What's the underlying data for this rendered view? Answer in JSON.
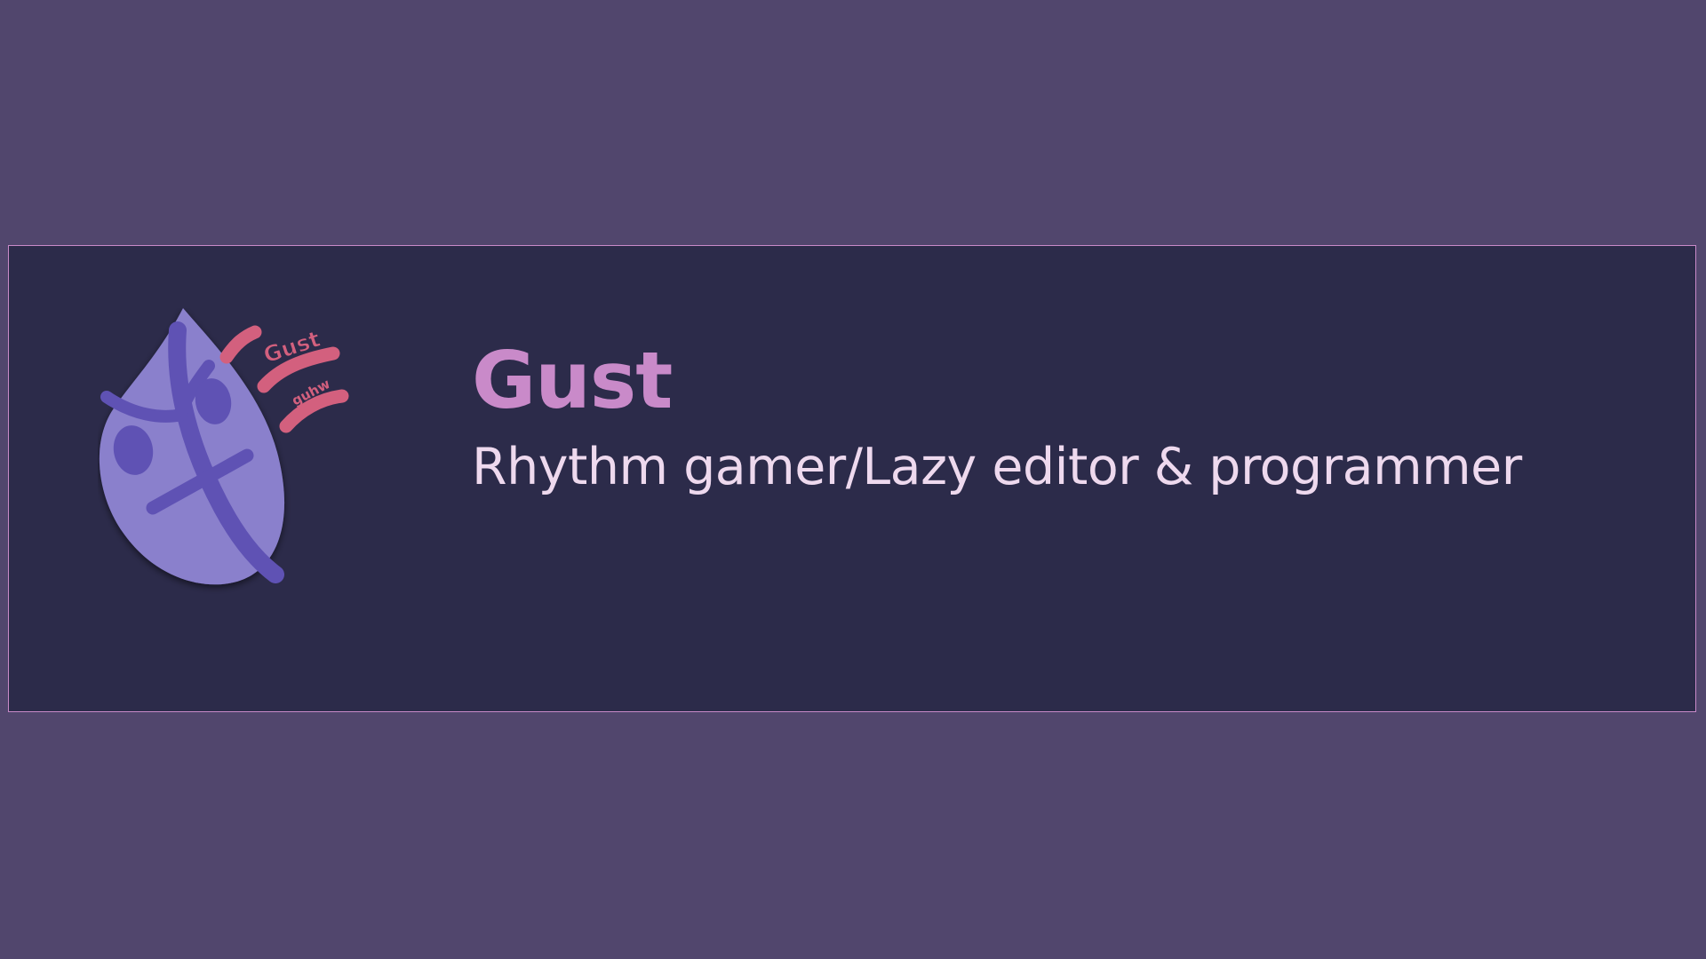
{
  "profile": {
    "name": "Gust",
    "tagline": "Rhythm gamer/Lazy editor & programmer",
    "avatar": {
      "icon": "leaf-face-icon",
      "wind_label_primary": "Gust",
      "wind_label_secondary": "guhw"
    }
  },
  "colors": {
    "background": "#51466d",
    "card": "#2c2b4a",
    "card_border": "#c98ac9",
    "name": "#c98ac9",
    "tagline": "#eed9ee",
    "leaf": "#8a80cc",
    "leaf_marks": "#5f52b4",
    "wind": "#d3607e"
  }
}
